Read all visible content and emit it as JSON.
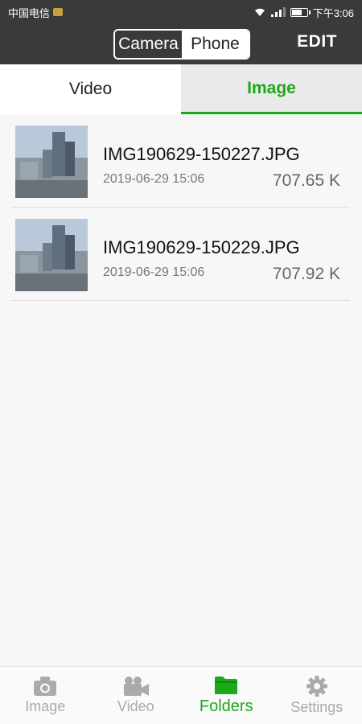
{
  "status_bar": {
    "carrier": "中国电信",
    "time": "下午3:06"
  },
  "header": {
    "segment_camera": "Camera",
    "segment_phone": "Phone",
    "edit": "EDIT"
  },
  "tabs": {
    "video": "Video",
    "image": "Image"
  },
  "files": [
    {
      "name": "IMG190629-150227.JPG",
      "date": "2019-06-29 15:06",
      "size": "707.65 K"
    },
    {
      "name": "IMG190629-150229.JPG",
      "date": "2019-06-29 15:06",
      "size": "707.92 K"
    }
  ],
  "bottom_nav": {
    "image": "Image",
    "video": "Video",
    "folders": "Folders",
    "settings": "Settings"
  },
  "colors": {
    "accent": "#19a919",
    "header_bg": "#3a3a3a"
  }
}
